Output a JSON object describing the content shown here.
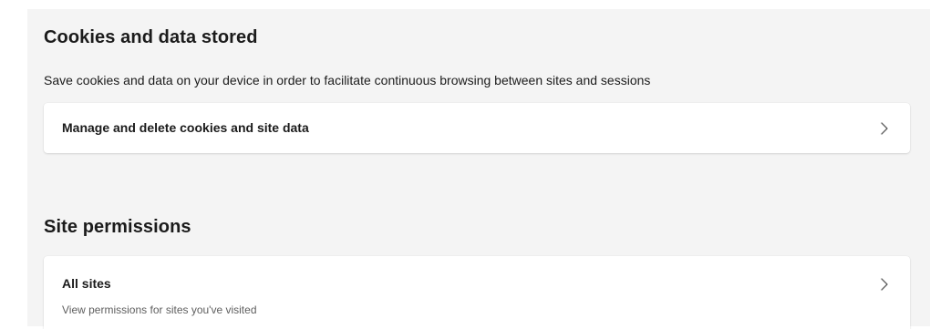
{
  "cookies": {
    "title": "Cookies and data stored",
    "description": "Save cookies and data on your device in order to facilitate continuous browsing between sites and sessions",
    "manage_item": {
      "label": "Manage and delete cookies and site data",
      "icon": "chevron-right-icon"
    }
  },
  "permissions": {
    "title": "Site permissions",
    "all_sites_item": {
      "label": "All sites",
      "description": "View permissions for sites you've visited",
      "icon": "chevron-right-icon"
    }
  },
  "colors": {
    "page_background": "#f4f4f4",
    "card_background": "#ffffff",
    "text_primary": "#1b1b1b",
    "text_secondary": "#5f5f5f"
  }
}
